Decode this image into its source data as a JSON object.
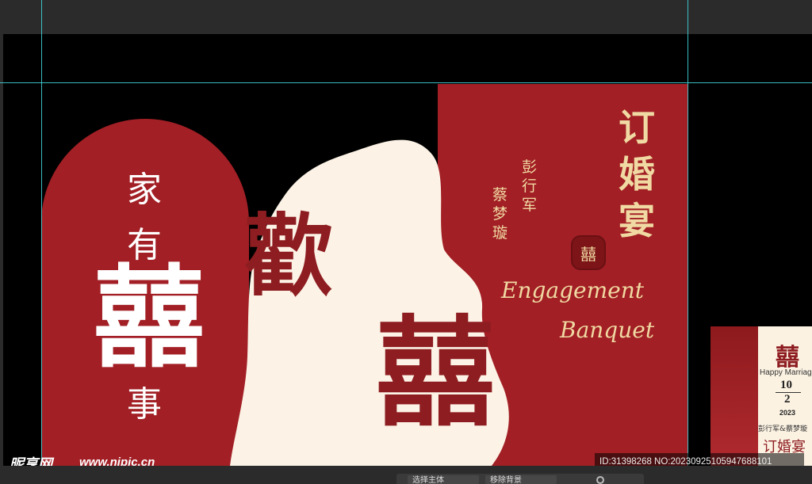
{
  "left_panel": {
    "top_chars": [
      "家",
      "有"
    ],
    "big_char": "囍",
    "bottom_char": "事"
  },
  "center": {
    "huan_char": "歡",
    "xi_char": "囍"
  },
  "right_panel": {
    "title_chars": [
      "订",
      "婚",
      "宴"
    ],
    "groom_chars": [
      "彭",
      "行",
      "军"
    ],
    "bride_chars": [
      "蔡",
      "梦",
      "璇"
    ],
    "seal_char": "囍",
    "english_line1": "Engagement",
    "english_line2": "Banquet"
  },
  "thumbnail": {
    "xi_char": "囍",
    "happy_marriage": "Happy Marriage",
    "day": "10",
    "month": "2",
    "year": "2023",
    "names": "彭行军&蔡梦璇",
    "title": "订婚宴"
  },
  "watermark": {
    "logo": "昵享网",
    "url": "www.nipic.cn",
    "id_text": "ID:31398268 NO:20230925105947688101"
  },
  "taskbar": {
    "items": [
      "选择主体",
      "移除背景"
    ]
  },
  "colors": {
    "red": "#a21f25",
    "cream": "#fcf3e6",
    "gold": "#f0d9a2",
    "dark_red": "#8e1d21"
  }
}
